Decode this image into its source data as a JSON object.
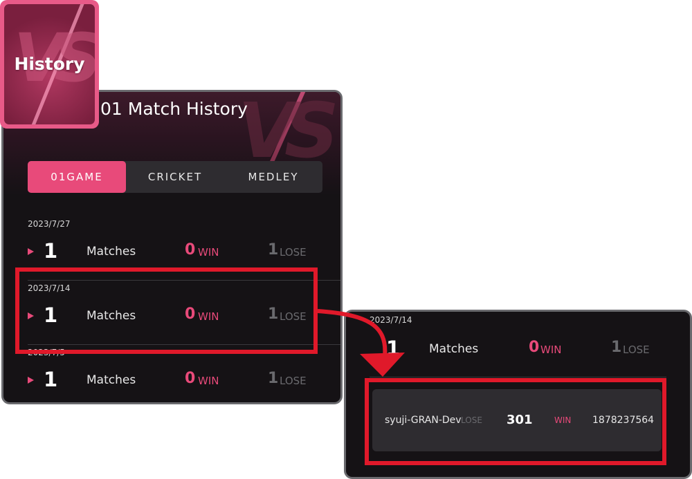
{
  "history_badge": {
    "label": "History",
    "icon": "vs-icon"
  },
  "panel": {
    "title": "01 Match History",
    "tabs": [
      {
        "label": "01GAME",
        "active": true
      },
      {
        "label": "CRICKET",
        "active": false
      },
      {
        "label": "MEDLEY",
        "active": false
      }
    ],
    "groups": [
      {
        "date": "2023/7/27",
        "count": "1",
        "matches_label": "Matches",
        "win_count": "0",
        "win_label": "WIN",
        "lose_count": "1",
        "lose_label": "LOSE"
      },
      {
        "date": "2023/7/14",
        "count": "1",
        "matches_label": "Matches",
        "win_count": "0",
        "win_label": "WIN",
        "lose_count": "1",
        "lose_label": "LOSE"
      },
      {
        "date": "2023/7/5",
        "count": "1",
        "matches_label": "Matches",
        "win_count": "0",
        "win_label": "WIN",
        "lose_count": "1",
        "lose_label": "LOSE"
      }
    ]
  },
  "zoom": {
    "date": "2023/7/14",
    "count": "1",
    "matches_label": "Matches",
    "win_count": "0",
    "win_label": "WIN",
    "lose_count": "1",
    "lose_label": "LOSE",
    "detail": {
      "player": "syuji-GRAN-Dev",
      "player_result": "LOSE",
      "game": "301",
      "opponent_result": "WIN",
      "opponent": "1878237564"
    }
  },
  "colors": {
    "accent": "#e84a7a",
    "highlight": "#e0192a",
    "panel_bg": "#151215",
    "muted": "#6a6a6e"
  }
}
